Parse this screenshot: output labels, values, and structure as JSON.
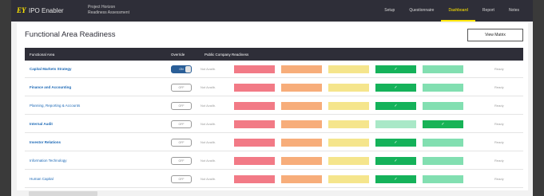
{
  "header": {
    "logo": "EY",
    "app_name": "IPO Enabler",
    "project_line1": "Project Horizon",
    "project_line2": "Readiness Assessment",
    "nav": [
      "Setup",
      "Questionnaire",
      "Dashboard",
      "Report",
      "Notes"
    ]
  },
  "page": {
    "title": "Functional Area Readiness",
    "view_button": "View Matrix"
  },
  "table": {
    "columns": [
      "Functional Area",
      "Override",
      "Public Company Readiness"
    ],
    "rows": [
      {
        "area": "Capital Markets Strategy",
        "override": "ON",
        "status": "Not Availb.",
        "ready": "Ready",
        "bold": true
      },
      {
        "area": "Finance and Accounting",
        "override": "OFF",
        "status": "Not Availb.",
        "ready": "Ready",
        "bold": true
      },
      {
        "area": "Planning, Reporting & Accounts",
        "override": "OFF",
        "status": "Not Availb.",
        "ready": "Ready",
        "bold": false
      },
      {
        "area": "Internal Audit",
        "override": "OFF",
        "status": "Not Availb.",
        "ready": "Ready",
        "bold": true
      },
      {
        "area": "Investor Relations",
        "override": "OFF",
        "status": "Not Availb.",
        "ready": "Ready",
        "bold": true
      },
      {
        "area": "Information Technology",
        "override": "OFF",
        "status": "Not Availb.",
        "ready": "Ready",
        "bold": false
      },
      {
        "area": "Human Capital",
        "override": "OFF",
        "status": "Not Availb.",
        "ready": "Ready",
        "bold": false
      }
    ]
  },
  "scale_colors": [
    "#f27a86",
    "#f7ad7a",
    "#f5e58c",
    "#15b25a",
    "#82dfb1"
  ],
  "check_glyph": "✓"
}
